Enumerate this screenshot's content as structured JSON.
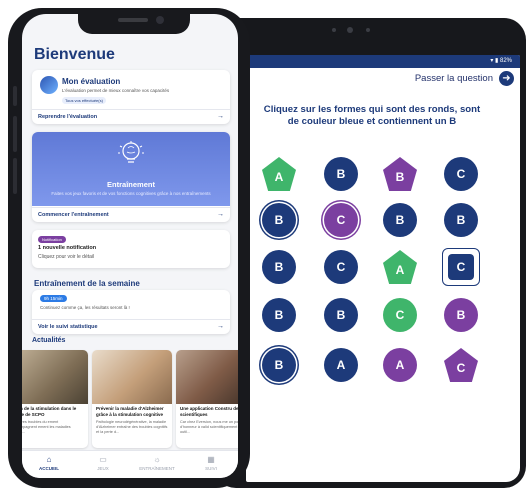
{
  "colors": {
    "navy": "#1d3a7a",
    "purple": "#7b3fa0",
    "green": "#3fb56b",
    "hero_blue": "#6f88e3",
    "tab_inactive": "#9aa0ad"
  },
  "tablet": {
    "status": "▾ ▮ 82%",
    "skip_label": "Passer la question",
    "skip_icon": "arrow-right-icon",
    "question": "Cliquez sur les formes qui sont des ronds, sont de couleur bleue et contiennent un B",
    "shapes": [
      {
        "kind": "pentagon",
        "color": "green",
        "letter": "A"
      },
      {
        "kind": "circle",
        "color": "navy",
        "letter": "B"
      },
      {
        "kind": "pentagon",
        "color": "purple",
        "letter": "B"
      },
      {
        "kind": "circle",
        "color": "navy",
        "letter": "C"
      },
      {
        "kind": "circle",
        "color": "navy",
        "letter": "B",
        "selected": true
      },
      {
        "kind": "circle",
        "color": "purple",
        "letter": "C",
        "selected": true
      },
      {
        "kind": "circle",
        "color": "navy",
        "letter": "B"
      },
      {
        "kind": "circle",
        "color": "navy",
        "letter": "B"
      },
      {
        "kind": "circle",
        "color": "navy",
        "letter": "B"
      },
      {
        "kind": "circle",
        "color": "navy",
        "letter": "C"
      },
      {
        "kind": "pentagon",
        "color": "green",
        "letter": "A"
      },
      {
        "kind": "square",
        "color": "navy",
        "letter": "C",
        "selected": true
      },
      {
        "kind": "circle",
        "color": "navy",
        "letter": "B"
      },
      {
        "kind": "circle",
        "color": "navy",
        "letter": "B"
      },
      {
        "kind": "circle",
        "color": "green",
        "letter": "C"
      },
      {
        "kind": "circle",
        "color": "purple",
        "letter": "B"
      },
      {
        "kind": "circle",
        "color": "navy",
        "letter": "B",
        "selected": true
      },
      {
        "kind": "circle",
        "color": "navy",
        "letter": "A"
      },
      {
        "kind": "circle",
        "color": "purple",
        "letter": "A"
      },
      {
        "kind": "pentagon",
        "color": "purple",
        "letter": "C"
      }
    ]
  },
  "phone": {
    "title": "Bienvenue",
    "evaluation": {
      "title": "Mon évaluation",
      "text": "L'évaluation permet de mieux connaître vos capacités",
      "chip": "Tous vos effectuée(s)",
      "link": "Reprendre l'évaluation"
    },
    "training": {
      "label": "Entraînement",
      "text": "Faites vos jeux favoris et de vos fonctions cognitives grâce à nos entraînements",
      "link": "Commencer l'entraînement"
    },
    "notification": {
      "badge": "Notification",
      "title": "1 nouvelle notification",
      "text": "Cliquez pour voir le détail"
    },
    "week": {
      "title": "Entraînement de la semaine",
      "chip": "9h 15min",
      "text": "Continuez comme ça, les résultats seront là !",
      "link": "Voir le suivi statistique"
    },
    "news": {
      "title": "Actualités",
      "items": [
        {
          "head": "ation de la stimulation dans le cadre de SCPO",
          "body": "et autres troubles du ement accompagnent ement les maladies neuro..."
        },
        {
          "head": "Prévenir la maladie d'Alzheimer grâce à la stimulation cognitive",
          "body": "Pathologie neurodégénérative, la maladie d'Alzheimer entraîne des troubles cognitifs et la perte d..."
        },
        {
          "head": "Une application Constru des scientifiques",
          "body": "Car chez Eversion, nous me un point d'honneur à valid scientifiquement tout outil..."
        }
      ]
    },
    "tabs": [
      {
        "label": "ACCUEIL",
        "icon": "home-icon"
      },
      {
        "label": "JEUX",
        "icon": "gamepad-icon"
      },
      {
        "label": "ENTRAÎNEMENT",
        "icon": "bulb-icon"
      },
      {
        "label": "SUIVI",
        "icon": "chart-icon"
      }
    ]
  }
}
